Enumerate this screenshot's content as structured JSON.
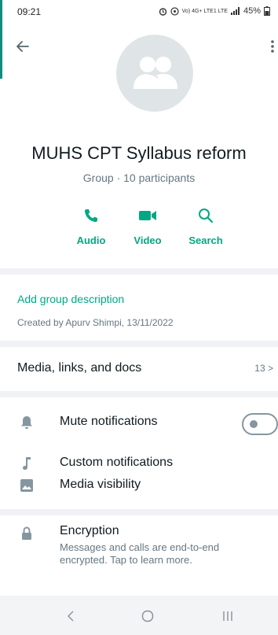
{
  "status_bar": {
    "time": "09:21",
    "network_label": "Vo) 4G+ LTE1 LTE",
    "battery": "45%"
  },
  "group": {
    "name": "MUHS CPT Syllabus reform",
    "meta": "Group · 10 participants"
  },
  "actions": [
    {
      "label": "Audio",
      "icon": "phone-icon"
    },
    {
      "label": "Video",
      "icon": "video-camera-icon"
    },
    {
      "label": "Search",
      "icon": "search-icon"
    }
  ],
  "description": {
    "add_label": "Add group description",
    "created": "Created by Apurv Shimpi, 13/11/2022"
  },
  "media": {
    "label": "Media, links, and docs",
    "count": "13 >"
  },
  "settings": [
    {
      "label": "Mute notifications",
      "icon": "bell-icon",
      "toggle_on": false
    },
    {
      "label": "Custom notifications",
      "icon": "music-note-icon"
    },
    {
      "label": "Media visibility",
      "icon": "image-icon"
    }
  ],
  "encryption": {
    "title": "Encryption",
    "description": "Messages and calls are end-to-end encrypted. Tap to learn more.",
    "icon": "lock-icon"
  },
  "colors": {
    "accent": "#00a884",
    "text": "#111b21",
    "secondary": "#667781",
    "divider": "#f0f2f5",
    "avatar_bg": "#dfe5e7"
  }
}
